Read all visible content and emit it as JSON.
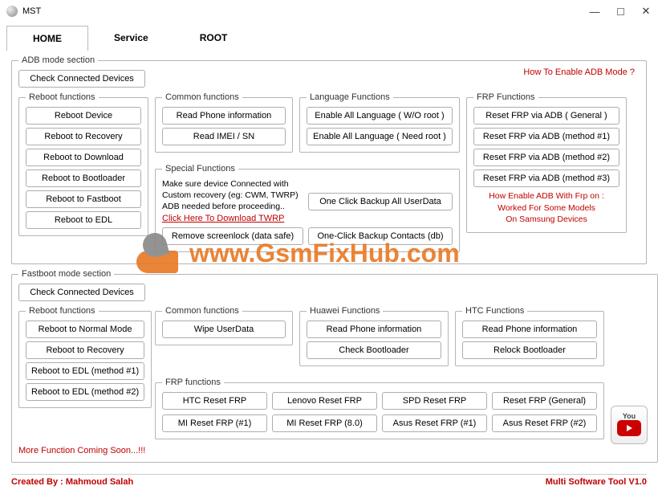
{
  "titlebar": {
    "title": "MST"
  },
  "tabs": {
    "home": "HOME",
    "service": "Service",
    "root": "ROOT"
  },
  "adb": {
    "legend": "ADB mode section",
    "how_link": "How To Enable ADB Mode ?",
    "check_devices": "Check Connected Devices",
    "reboot": {
      "legend": "Reboot functions",
      "device": "Reboot Device",
      "recovery": "Reboot to Recovery",
      "download": "Reboot to Download",
      "bootloader": "Reboot to Bootloader",
      "fastboot": "Reboot to Fastboot",
      "edl": "Reboot to EDL"
    },
    "common": {
      "legend": "Common functions",
      "read_info": "Read Phone information",
      "read_imei": "Read IMEI / SN"
    },
    "lang": {
      "legend": "Language Functions",
      "wo_root": "Enable All Language ( W/O root )",
      "need_root": "Enable All Language ( Need root )"
    },
    "frp": {
      "legend": "FRP Functions",
      "general": "Reset FRP via ADB ( General )",
      "m1": "Reset FRP via ADB (method #1)",
      "m2": "Reset FRP via ADB (method #2)",
      "m3": "Reset FRP via ADB (method #3)",
      "note1": "How Enable ADB With Frp on :",
      "note2": "Worked For Some Models",
      "note3": "On Samsung Devices"
    },
    "special": {
      "legend": "Special Functions",
      "text1": "Make sure device Connected with Custom recovery (eg: CWM, TWRP)",
      "text2": "ADB needed before proceeding..",
      "link": "Click Here To Download TWRP",
      "remove_lock": "Remove screenlock (data safe)",
      "backup_user": "One Click Backup All UserData",
      "backup_contacts": "One-Click Backup Contacts (db)"
    }
  },
  "fastboot": {
    "legend": "Fastboot mode section",
    "check_devices": "Check Connected Devices",
    "reboot": {
      "legend": "Reboot functions",
      "normal": "Reboot to Normal Mode",
      "recovery": "Reboot to Recovery",
      "edl1": "Reboot to EDL  (method #1)",
      "edl2": "Reboot to EDL  (method #2)"
    },
    "common": {
      "legend": "Common functions",
      "wipe": "Wipe UserData"
    },
    "huawei": {
      "legend": "Huawei Functions",
      "read_info": "Read Phone information",
      "check_bl": "Check Bootloader"
    },
    "htc": {
      "legend": "HTC Functions",
      "read_info": "Read Phone information",
      "relock": "Relock Bootloader"
    },
    "frp": {
      "legend": "FRP functions",
      "htc": "HTC Reset FRP",
      "lenovo": "Lenovo Reset FRP",
      "spd": "SPD Reset FRP",
      "general": "Reset FRP (General)",
      "mi1": "MI Reset FRP  (#1)",
      "mi80": "MI Reset FRP  (8.0)",
      "asus1": "Asus Reset FRP  (#1)",
      "asus2": "Asus Reset FRP  (#2)"
    },
    "more": "More Function Coming Soon...!!!"
  },
  "footer": {
    "left": "Created By : Mahmoud Salah",
    "right": "Multi Software Tool V1.0"
  },
  "watermark": "www.GsmFixHub.com",
  "youtube": "Tube"
}
